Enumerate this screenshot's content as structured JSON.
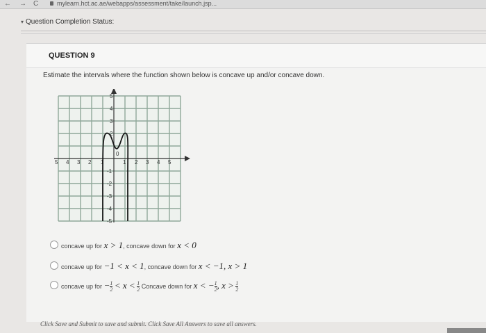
{
  "browser": {
    "back": "←",
    "forward": "→",
    "reload": "C",
    "url": "mylearn.hct.ac.ae/webapps/assessment/take/launch.jsp..."
  },
  "status": {
    "chevron": "▾",
    "label": "Question Completion Status:"
  },
  "question": {
    "title": "QUESTION 9",
    "prompt": "Estimate the intervals where the function shown below is concave up and/or concave down."
  },
  "graph": {
    "x_ticks": [
      "5",
      "4",
      "3",
      "2",
      "1",
      "0",
      "1",
      "2",
      "3",
      "4",
      "5"
    ],
    "y_ticks_pos": [
      "5",
      "4",
      "3",
      "2"
    ],
    "y_ticks_neg": [
      "-1",
      "-2",
      "-3",
      "-4",
      "-5"
    ]
  },
  "options": [
    {
      "prefix": "concave up for",
      "up": "x > 1",
      "mid": "concave down for",
      "down": "x < 0"
    },
    {
      "prefix": "concave up for",
      "up": "−1 < x < 1",
      "mid": "concave down for",
      "down": "x < −1, x > 1"
    },
    {
      "prefix": "concave up for",
      "up_a": "−",
      "up_b": "< x <",
      "mid": "Concave down for",
      "down_a": "x < −",
      "down_b": ", x >",
      "frac_num": "1",
      "frac_den": "2"
    }
  ],
  "footer": {
    "text": "Click Save and Submit to save and submit. Click Save All Answers to save all answers."
  }
}
